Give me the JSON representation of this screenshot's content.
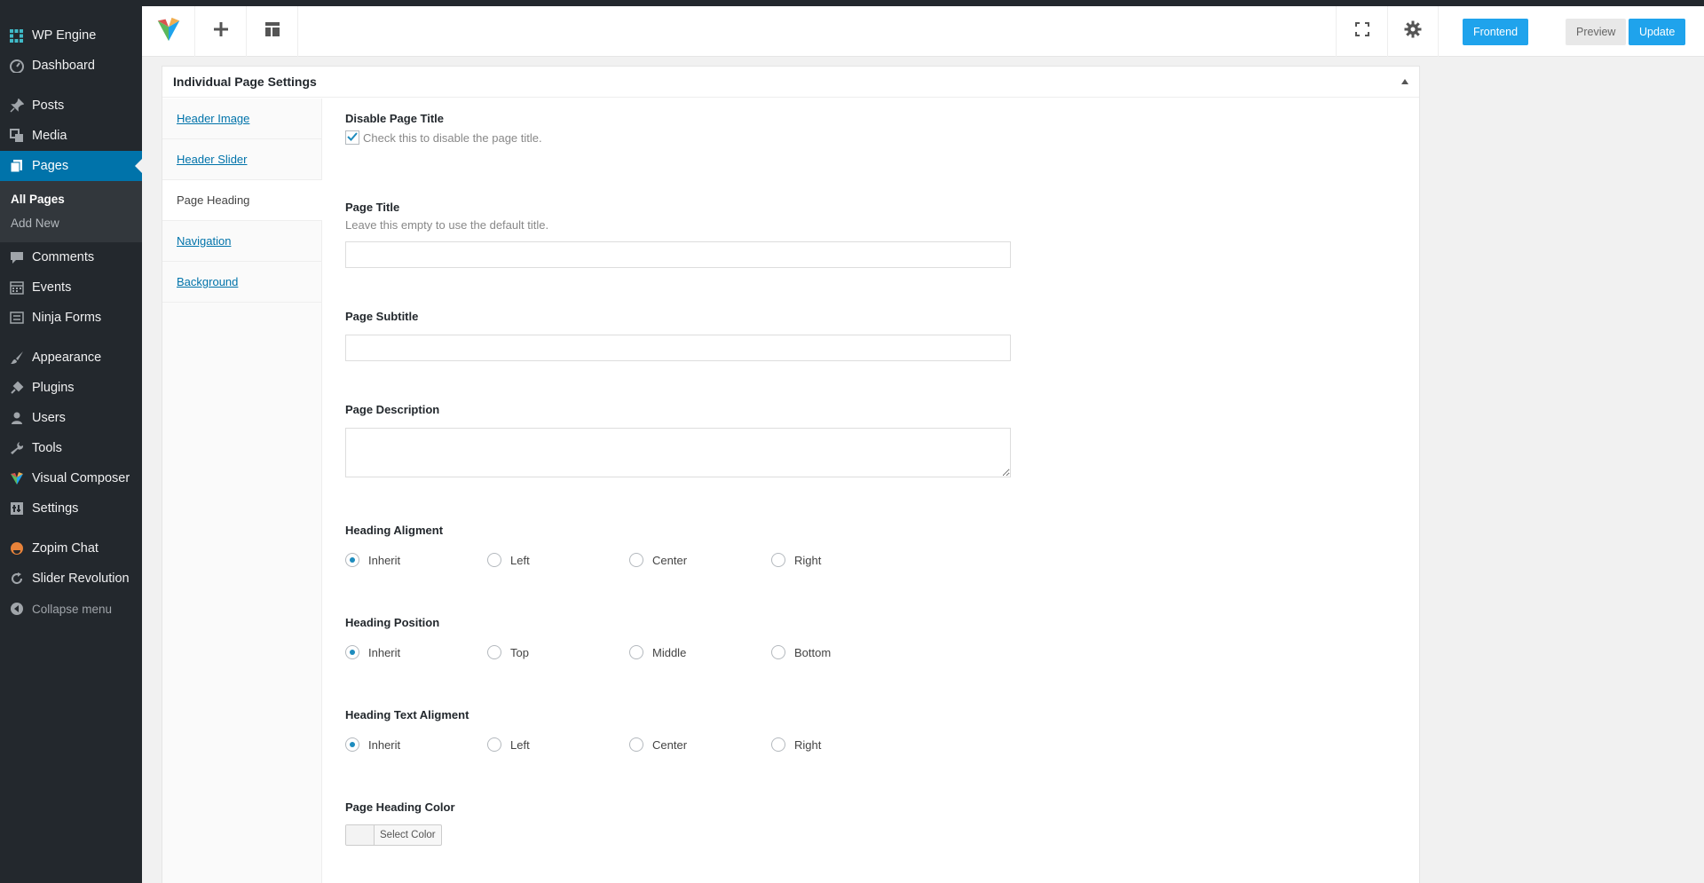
{
  "sidebar": {
    "items": [
      {
        "label": "WP Engine",
        "icon": "wp-engine-icon"
      },
      {
        "label": "Dashboard",
        "icon": "dashboard-icon"
      },
      {
        "label": "Posts",
        "icon": "pin-icon"
      },
      {
        "label": "Media",
        "icon": "media-icon"
      },
      {
        "label": "Pages",
        "icon": "pages-icon"
      },
      {
        "label": "Comments",
        "icon": "comment-icon"
      },
      {
        "label": "Events",
        "icon": "calendar-icon"
      },
      {
        "label": "Ninja Forms",
        "icon": "forms-icon"
      },
      {
        "label": "Appearance",
        "icon": "brush-icon"
      },
      {
        "label": "Plugins",
        "icon": "plug-icon"
      },
      {
        "label": "Users",
        "icon": "user-icon"
      },
      {
        "label": "Tools",
        "icon": "wrench-icon"
      },
      {
        "label": "Visual Composer",
        "icon": "visual-composer-icon"
      },
      {
        "label": "Settings",
        "icon": "settings-icon"
      },
      {
        "label": "Zopim Chat",
        "icon": "chat-icon"
      },
      {
        "label": "Slider Revolution",
        "icon": "refresh-icon"
      },
      {
        "label": "Collapse menu",
        "icon": "collapse-icon"
      }
    ],
    "submenu": {
      "all_pages": "All Pages",
      "add_new": "Add New"
    }
  },
  "toolbar": {
    "frontend": "Frontend",
    "preview": "Preview",
    "update": "Update"
  },
  "panel": {
    "title": "Individual Page Settings",
    "tabs": [
      "Header Image",
      "Header Slider",
      "Page Heading",
      "Navigation",
      "Background"
    ],
    "active_tab": "Page Heading"
  },
  "form": {
    "disable_title": {
      "label": "Disable Page Title",
      "checkbox_text": "Check this to disable the page title.",
      "checked": true
    },
    "page_title": {
      "label": "Page Title",
      "description": "Leave this empty to use the default title.",
      "value": ""
    },
    "page_subtitle": {
      "label": "Page Subtitle",
      "value": ""
    },
    "page_description": {
      "label": "Page Description",
      "value": ""
    },
    "heading_alignment": {
      "label": "Heading Aligment",
      "options": [
        "Inherit",
        "Left",
        "Center",
        "Right"
      ],
      "selected": "Inherit"
    },
    "heading_position": {
      "label": "Heading Position",
      "options": [
        "Inherit",
        "Top",
        "Middle",
        "Bottom"
      ],
      "selected": "Inherit"
    },
    "heading_text_alignment": {
      "label": "Heading Text Aligment",
      "options": [
        "Inherit",
        "Left",
        "Center",
        "Right"
      ],
      "selected": "Inherit"
    },
    "heading_color": {
      "label": "Page Heading Color",
      "button": "Select Color"
    }
  },
  "colors": {
    "sidebar_bg": "#23282d",
    "active_menu": "#0073aa",
    "button_blue": "#1fa3ec",
    "link": "#0073aa"
  }
}
